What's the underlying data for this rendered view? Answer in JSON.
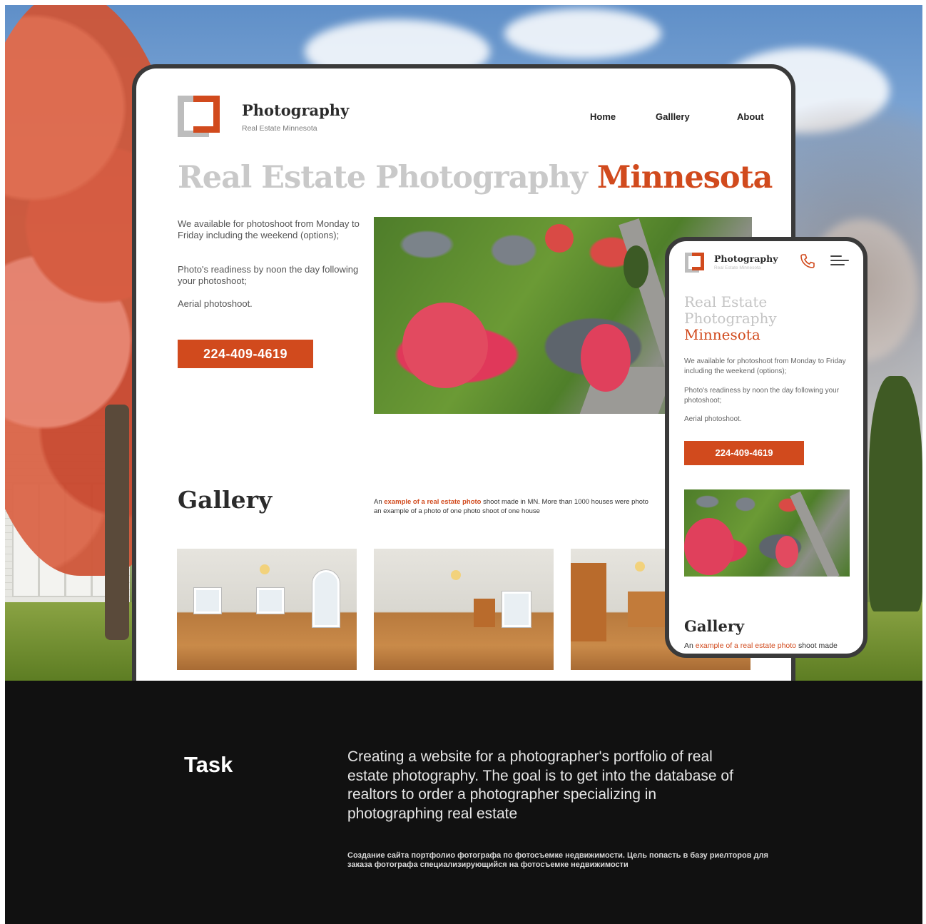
{
  "colors": {
    "accent": "#d14a1d",
    "headline_grey": "#c9c9c9",
    "dark_bg": "#111111"
  },
  "desktop": {
    "brand_name": "Photography",
    "brand_sub": "Real Estate Minnesota",
    "nav": [
      "Home",
      "Galllery",
      "About"
    ],
    "headline_grey": "Real Estate Photography",
    "headline_accent": "Minnesota",
    "paragraphs": [
      "We available for photoshoot from Monday to Friday including the weekend (options);",
      "Photo's readiness by noon the day following your photoshoot;",
      "Aerial photoshoot."
    ],
    "phone": "224-409-4619",
    "gallery_title": "Gallery",
    "gallery_text_pre": "An ",
    "gallery_text_link": "example of a real estate photo",
    "gallery_text_post": " shoot made in MN. More than 1000 houses were photo",
    "gallery_text_line2": "an example of a photo of one photo shoot of one house"
  },
  "mobile": {
    "brand_name": "Photography",
    "brand_sub": "Real Estate Minnesota",
    "phone_icon": "phone-icon",
    "menu_icon": "hamburger-menu-icon",
    "headline_grey_1": "Real Estate",
    "headline_grey_2": "Photography",
    "headline_accent": "Minnesota",
    "paragraphs": [
      "We available for photoshoot from Monday to Friday including the weekend (options);",
      "Photo's readiness by noon the day following your photoshoot;",
      "Aerial photoshoot."
    ],
    "phone": "224-409-4619",
    "gallery_title": "Gallery",
    "gallery_text_pre": "An ",
    "gallery_text_link": "example of a real estate photo",
    "gallery_text_post": " shoot made"
  },
  "task": {
    "title": "Task",
    "text_en": "Creating a website for a photographer's portfolio of real estate photography. The goal is to get into the database of realtors to order a photographer specializing in photographing real estate",
    "text_ru": "Создание сайта портфолио фотографа по фотосъемке недвижимости. Цель попасть в базу риелторов для заказа фотографа специализирующийся на фотосъемке недвижимости"
  }
}
